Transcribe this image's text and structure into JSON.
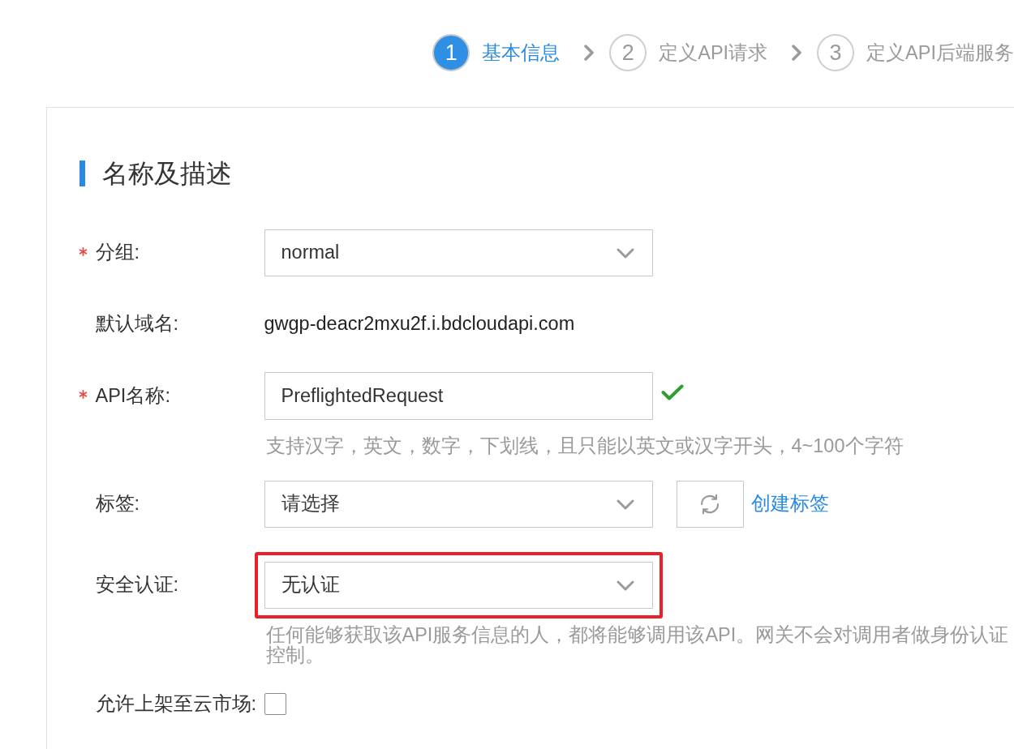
{
  "steps": [
    {
      "number": "1",
      "label": "基本信息",
      "selected": true
    },
    {
      "number": "2",
      "label": "定义API请求",
      "selected": false
    },
    {
      "number": "3",
      "label": "定义API后端服务",
      "selected": false
    }
  ],
  "section": {
    "title": "名称及描述",
    "fields": [
      {
        "kind": "select",
        "label": "分组:",
        "required": true,
        "value": "normal"
      },
      {
        "kind": "text",
        "label": "默认域名:",
        "required": false,
        "value": "gwgp-deacr2mxu2f.i.bdcloudapi.com"
      },
      {
        "kind": "input",
        "label": "API名称:",
        "required": true,
        "value": "PreflightedRequest",
        "valid": true,
        "hint_lines": [
          "支持汉字，英文，数字，下划线，且只能以英文或汉字开头，4~100个字符"
        ]
      },
      {
        "kind": "select",
        "label": "标签:",
        "required": false,
        "placeholder": "请选择",
        "refresh_button": true,
        "link": "创建标签"
      },
      {
        "kind": "select",
        "label": "安全认证:",
        "required": false,
        "value": "无认证",
        "highlighted": true,
        "hint_lines": [
          "任何能够获取该API服务信息的人，都将能够调用该API。网关不会对调用者做身份认证",
          "控制。"
        ]
      },
      {
        "kind": "checkbox",
        "label": "允许上架至云市场:",
        "required": false,
        "checked": false
      }
    ]
  }
}
